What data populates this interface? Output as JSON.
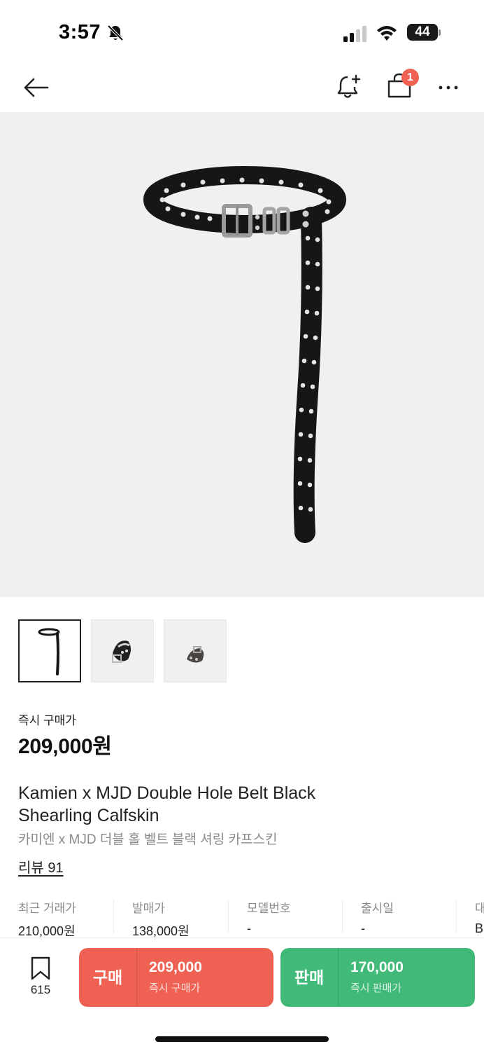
{
  "status_bar": {
    "time": "3:57",
    "battery": "44"
  },
  "nav": {
    "cart_badge": "1"
  },
  "price": {
    "label": "즉시 구매가",
    "value": "209,000원"
  },
  "product": {
    "title_en": "Kamien x MJD Double Hole Belt Black Shearling Calfskin",
    "title_ko": "카미엔 x MJD 더블 홀 벨트 블랙 셔링 카프스킨",
    "review": "리뷰 91"
  },
  "info": [
    {
      "label": "최근 거래가",
      "value": "210,000원"
    },
    {
      "label": "발매가",
      "value": "138,000원"
    },
    {
      "label": "모델번호",
      "value": "-"
    },
    {
      "label": "출시일",
      "value": "-"
    },
    {
      "label": "대",
      "value": "B"
    }
  ],
  "bottom": {
    "bookmark_count": "615",
    "buy": {
      "kind": "구매",
      "price": "209,000",
      "sub": "즉시 구매가"
    },
    "sell": {
      "kind": "판매",
      "price": "170,000",
      "sub": "즉시 판매가"
    }
  },
  "colors": {
    "buy": "#ef6253",
    "sell": "#41b979",
    "badge": "#ef6253"
  }
}
